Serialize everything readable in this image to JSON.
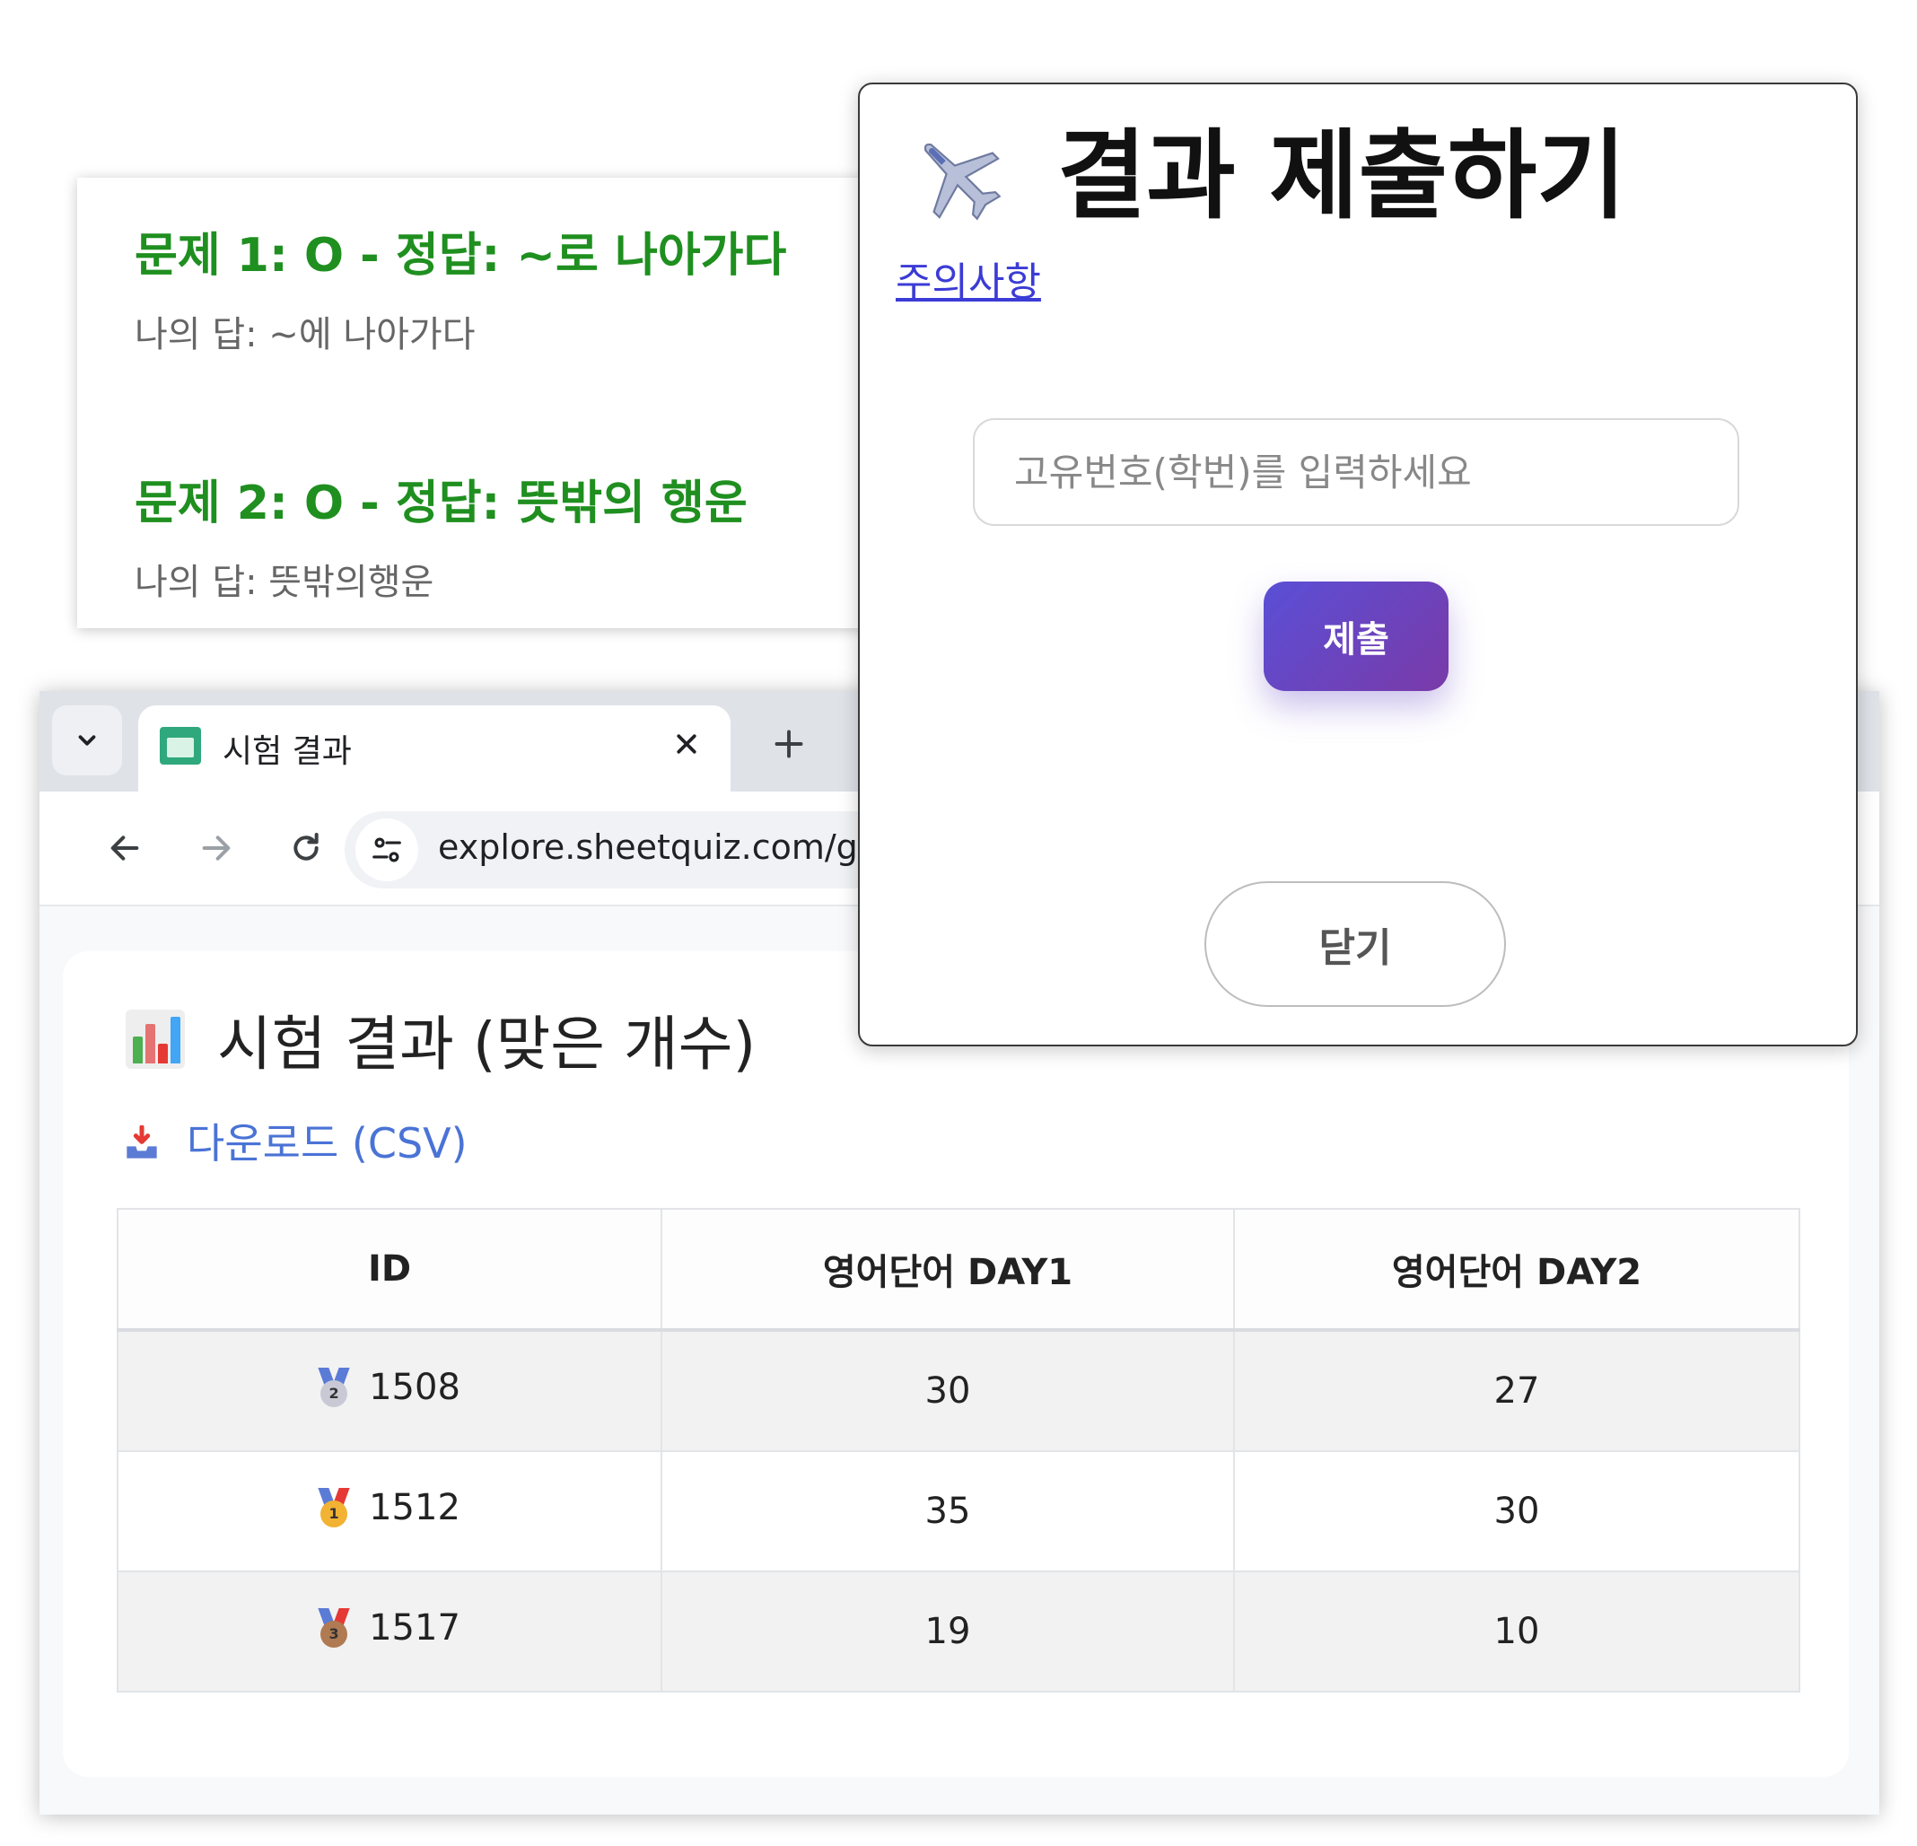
{
  "quiz_results": {
    "items": [
      {
        "title": "문제 1: O - 정답: ~로 나아가다",
        "my_answer": "나의 답: ~에 나아가다"
      },
      {
        "title": "문제 2: O - 정답: 뜻밖의 행운",
        "my_answer": "나의 답: 뜻밖의행운"
      }
    ],
    "title_color": "#1f8f1f"
  },
  "browser": {
    "tab": {
      "title": "시험 결과",
      "favicon": "table-favicon-icon"
    },
    "url": "explore.sheetquiz.com/get",
    "icons": {
      "back": "arrow-left-icon",
      "forward": "arrow-right-icon",
      "reload": "reload-icon",
      "site_info": "tune-icon",
      "close_tab": "close-icon",
      "new_tab": "plus-icon",
      "tab_list": "chevron-down-icon"
    }
  },
  "results_page": {
    "title": "시험 결과 (맞은 개수)",
    "title_icon": "bar-chart-icon",
    "download_label": "다운로드 (CSV)",
    "download_icon": "inbox-tray-icon",
    "link_color": "#4a73d6",
    "table": {
      "headers": [
        "ID",
        "영어단어 DAY1",
        "영어단어 DAY2"
      ],
      "rows": [
        {
          "medal": "2",
          "medal_icon": "second-place-medal-icon",
          "id": "1508",
          "day1": "30",
          "day2": "27"
        },
        {
          "medal": "1",
          "medal_icon": "first-place-medal-icon",
          "id": "1512",
          "day1": "35",
          "day2": "30"
        },
        {
          "medal": "3",
          "medal_icon": "third-place-medal-icon",
          "id": "1517",
          "day1": "19",
          "day2": "10"
        }
      ]
    }
  },
  "submit_modal": {
    "title": "결과 제출하기",
    "title_icon": "airplane-icon",
    "notice_link": "주의사항",
    "input_placeholder": "고유번호(학번)를 입력하세요",
    "input_value": "",
    "submit_label": "제출",
    "close_label": "닫기",
    "accent_gradient": [
      "#5a4fd6",
      "#7a3aa8"
    ]
  }
}
